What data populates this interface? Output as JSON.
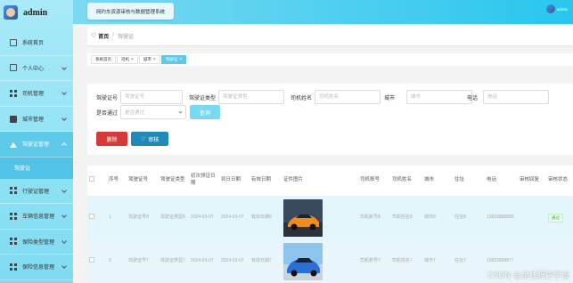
{
  "brand": {
    "name": "admin"
  },
  "sidebar": {
    "items": [
      {
        "label": "系统首页",
        "icon": "home-icon",
        "active": false,
        "expandable": false
      },
      {
        "label": "个人中心",
        "icon": "user-icon",
        "active": false,
        "expandable": true
      },
      {
        "label": "司机管理",
        "icon": "grid-icon",
        "active": false,
        "expandable": true
      },
      {
        "label": "城市管理",
        "icon": "briefcase-icon",
        "active": false,
        "expandable": true
      },
      {
        "label": "驾驶证管理",
        "icon": "upload-icon",
        "active": true,
        "expandable": true
      },
      {
        "label": "行驶证管理",
        "icon": "grid-icon",
        "active": false,
        "expandable": true
      },
      {
        "label": "车辆信息管理",
        "icon": "grid-icon",
        "active": false,
        "expandable": true
      },
      {
        "label": "保险类型管理",
        "icon": "grid-icon",
        "active": false,
        "expandable": true
      },
      {
        "label": "保险信息管理",
        "icon": "grid-icon",
        "active": false,
        "expandable": true
      }
    ],
    "submenu": {
      "label": "驾驶证"
    }
  },
  "header": {
    "system_title": "网约车资源审核与数据管理系统",
    "user_name": "admin"
  },
  "breadcrumb": {
    "home": "首页",
    "separator": "/",
    "current": "驾驶证"
  },
  "tabs": [
    {
      "label": "系统首页",
      "closable": false,
      "active": false
    },
    {
      "label": "司机",
      "closable": true,
      "active": false
    },
    {
      "label": "城市",
      "closable": true,
      "active": false
    },
    {
      "label": "驾驶证",
      "closable": true,
      "active": true
    }
  ],
  "filters": {
    "license_no": {
      "label": "驾驶证号",
      "placeholder": "驾驶证号"
    },
    "license_type": {
      "label": "驾驶证类型",
      "placeholder": "驾驶证类型"
    },
    "driver_name": {
      "label": "司机姓名",
      "placeholder": "司机姓名"
    },
    "city": {
      "label": "城市",
      "placeholder": "城市"
    },
    "phone": {
      "label": "电话",
      "placeholder": "电话"
    },
    "passed": {
      "label": "是否通过",
      "placeholder": "是否通过"
    },
    "query_button": "查询"
  },
  "actions": {
    "delete": "删除",
    "review": "审核"
  },
  "table": {
    "columns": [
      "序号",
      "驾驶证号",
      "驾驶证类型",
      "初次领证日期",
      "到日日期",
      "有效日期",
      "证件图片",
      "司机账号",
      "司机姓名",
      "城市",
      "住址",
      "电话",
      "审核回复",
      "审核状态"
    ],
    "rows": [
      {
        "index": "1",
        "license_no": "驾驶证号8",
        "license_type": "驾驶证类型8",
        "first_issue": "2024-03-07",
        "expire": "2024-03-07",
        "valid": "有效日期8",
        "image": "orange-car",
        "driver_account": "司机账号8",
        "driver_name": "司机姓名8",
        "city": "城市8",
        "address": "住址8",
        "phone": "13823888888",
        "reply": "",
        "status": "通过"
      },
      {
        "index": "2",
        "license_no": "驾驶证号7",
        "license_type": "驾驶证类型7",
        "first_issue": "2024-03-07",
        "expire": "2024-03-07",
        "valid": "有效日期7",
        "image": "blue-car",
        "driver_account": "司机账号7",
        "driver_name": "司机姓名7",
        "city": "城市7",
        "address": "住址7",
        "phone": "13823888877",
        "reply": "",
        "status": ""
      }
    ]
  },
  "watermark": "CSDN @全栈程序学设",
  "colors": {
    "sidebar": "#7fdbf2",
    "topbar": "#28c6ee",
    "accent": "#5ec9e9",
    "delete": "#d43a3a",
    "review": "#1f8ab8",
    "row_highlight": "#e3f6fc"
  }
}
